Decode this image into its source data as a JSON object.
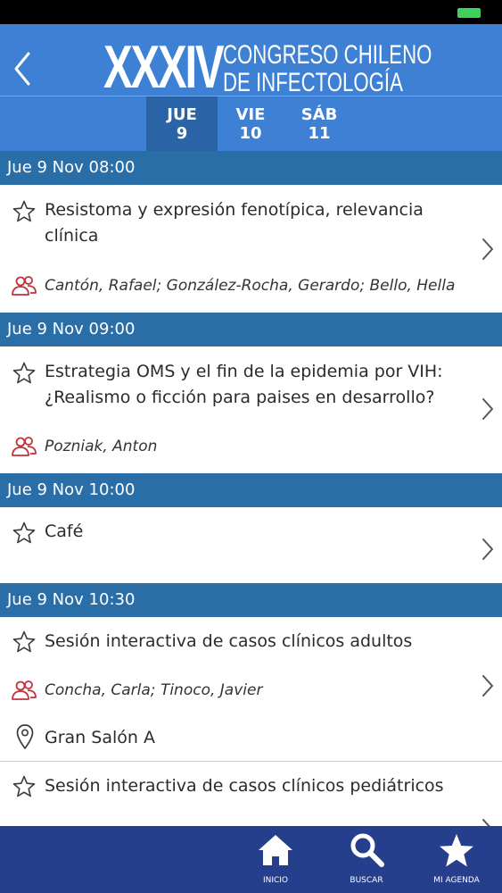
{
  "header": {
    "logo_number": "XXXIV",
    "logo_line1": "CONGRESO CHILENO",
    "logo_line2": "DE INFECTOLOGÍA"
  },
  "days": [
    {
      "name": "JUE",
      "num": "9",
      "active": true
    },
    {
      "name": "VIE",
      "num": "10",
      "active": false
    },
    {
      "name": "SÁB",
      "num": "11",
      "active": false
    }
  ],
  "sessions": [
    {
      "time_header": "Jue 9 Nov 08:00",
      "title": "Resistoma y expresión fenotípica, relevancia clínica",
      "speakers": "Cantón, Rafael; González-Rocha, Gerardo; Bello, Hella"
    },
    {
      "time_header": "Jue 9 Nov 09:00",
      "title": "Estrategia OMS y el fin de la epidemia por VIH: ¿Realismo o ficción para paises en desarrollo?",
      "speakers": "Pozniak, Anton"
    },
    {
      "time_header": "Jue 9 Nov 10:00",
      "title": "Café"
    },
    {
      "time_header": "Jue 9 Nov 10:30",
      "title": "Sesión interactiva de casos clínicos adultos",
      "speakers": "Concha, Carla; Tinoco, Javier",
      "location": "Gran Salón A"
    },
    {
      "title": "Sesión interactiva de casos clínicos pediátricos"
    }
  ],
  "tabbar": [
    {
      "label": "INICIO",
      "icon": "home-icon"
    },
    {
      "label": "BUSCAR",
      "icon": "search-icon"
    },
    {
      "label": "MI AGENDA",
      "icon": "star-icon"
    }
  ],
  "colors": {
    "header_blue": "#3d80d4",
    "section_blue": "#2a6ea8",
    "active_day": "#2a64a7",
    "tabbar_navy": "#253f8d",
    "speaker_icon_red": "#c0323c"
  }
}
